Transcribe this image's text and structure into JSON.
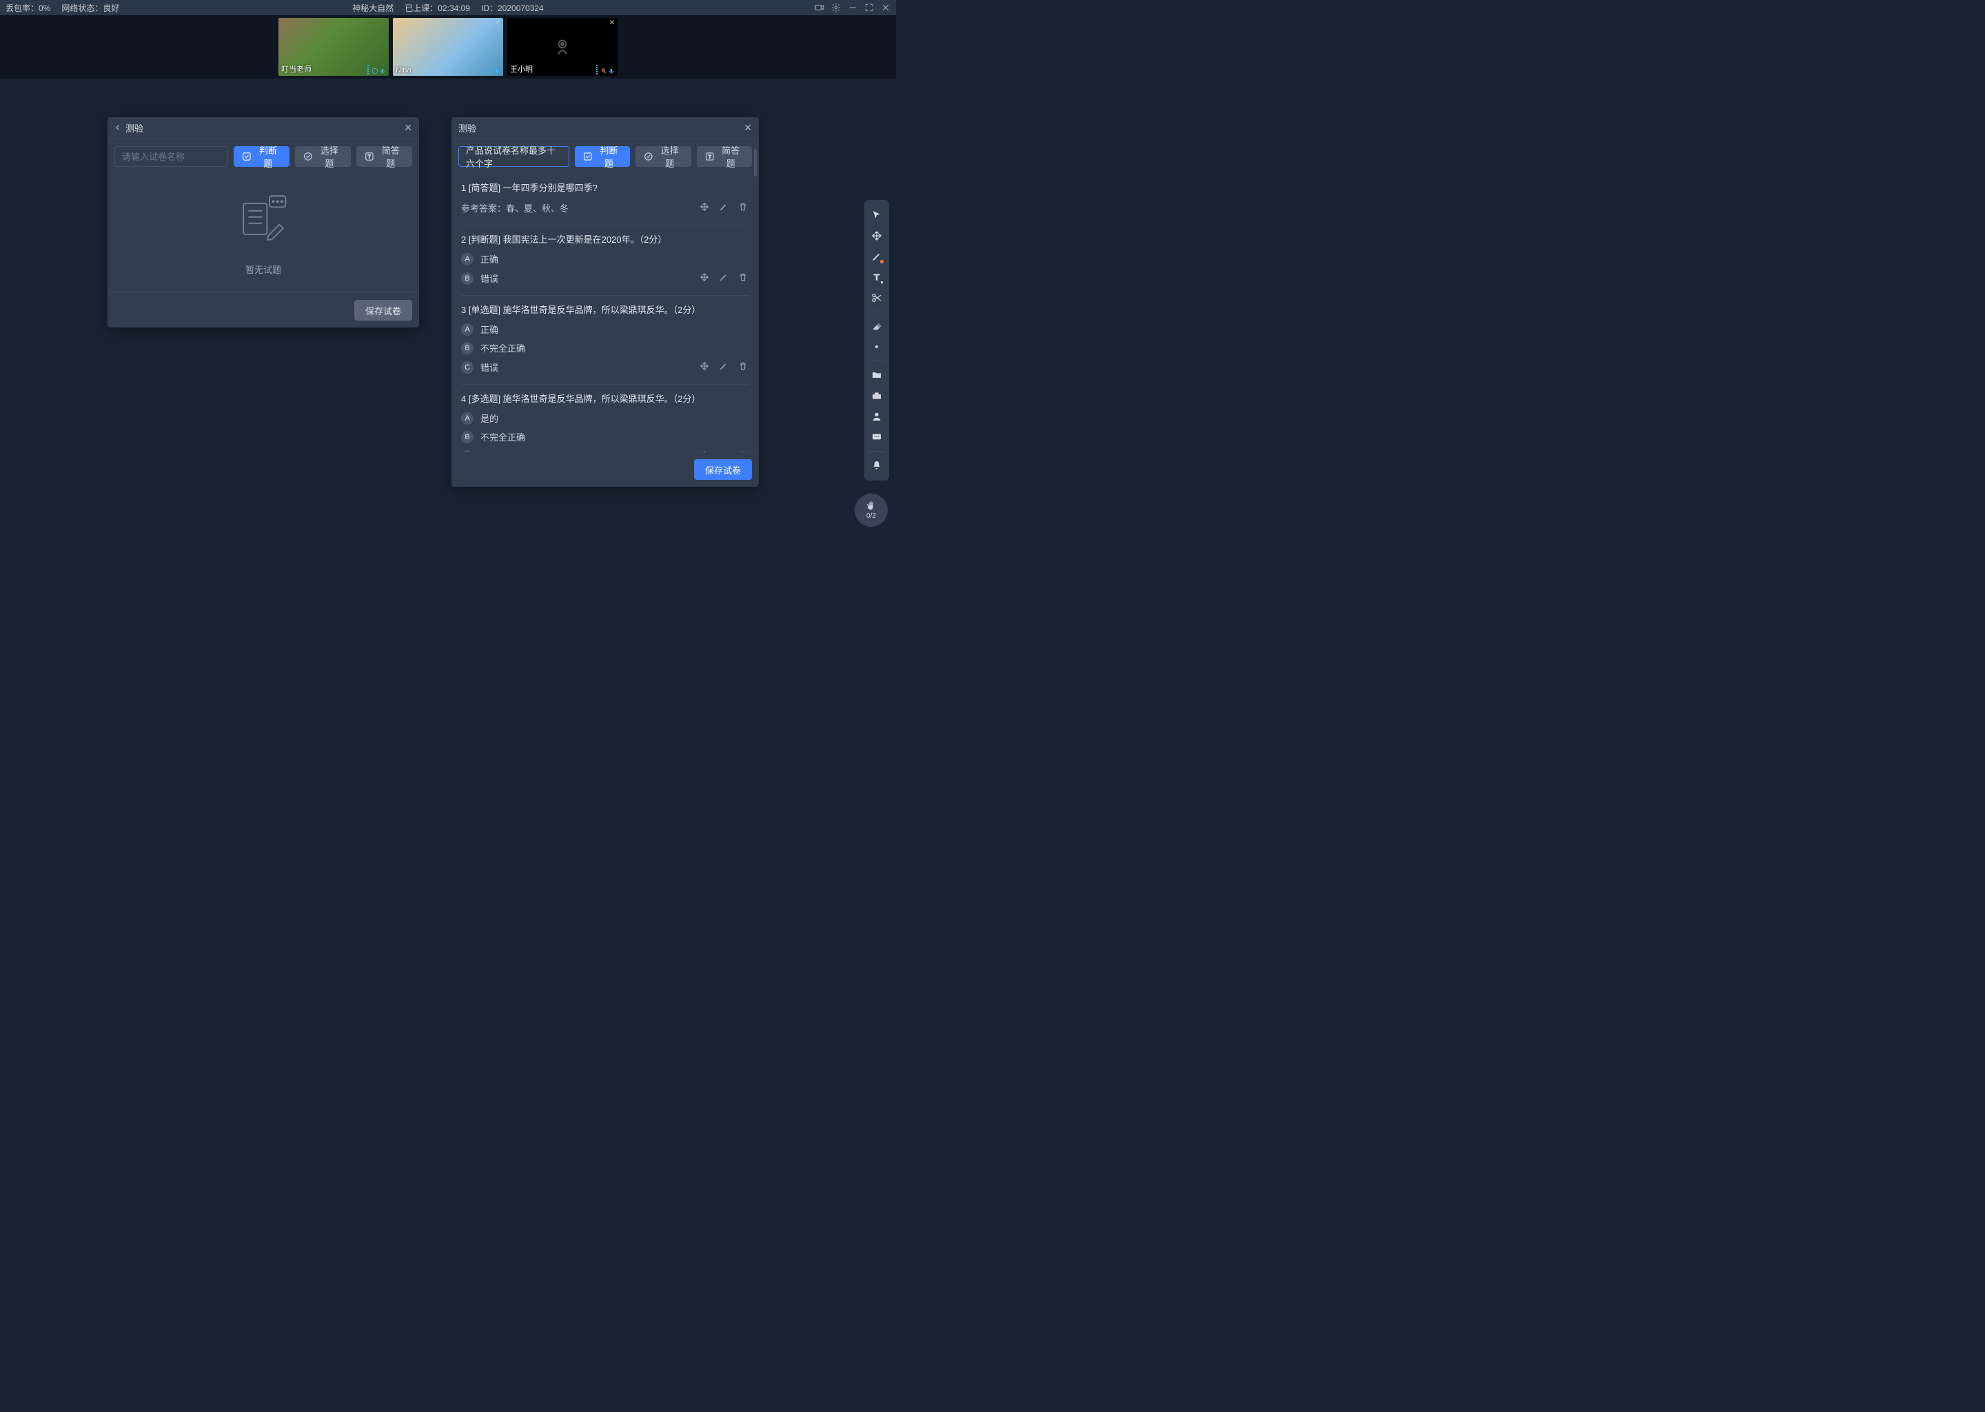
{
  "top_bar": {
    "packet_loss_label": "丢包率：0%",
    "network_label": "网络状态：良好",
    "course_title": "神秘大自然",
    "elapsed_label": "已上课：02:34:09",
    "session_id_label": "ID：2020070324"
  },
  "video_tiles": [
    {
      "name": "叮当老师",
      "has_close": false,
      "camera_off": false,
      "mic_muted": false
    },
    {
      "name": "Nina",
      "has_close": true,
      "camera_off": false,
      "mic_muted": false
    },
    {
      "name": "王小明",
      "has_close": true,
      "camera_off": true,
      "mic_muted": true
    }
  ],
  "panel_left": {
    "title": "测验",
    "name_placeholder": "请输入试卷名称",
    "buttons": {
      "judgment": "判断题",
      "choice": "选择题",
      "short_answer": "简答题"
    },
    "empty_text": "暂无试题",
    "save_button": "保存试卷"
  },
  "panel_right": {
    "title": "测验",
    "name_value": "产品说试卷名称最多十六个字",
    "buttons": {
      "judgment": "判断题",
      "choice": "选择题",
      "short_answer": "简答题"
    },
    "save_button": "保存试卷"
  },
  "questions": [
    {
      "num": "1",
      "title_prefix": "[简答题]",
      "text": "一年四季分别是哪四季?",
      "answer_label": "参考答案：春、夏、秋、冬",
      "options": []
    },
    {
      "num": "2",
      "title_prefix": "[判断题]",
      "text": "我国宪法上一次更新是在2020年。",
      "score_suffix": "（2分）",
      "options": [
        {
          "badge": "A",
          "text": "正确"
        },
        {
          "badge": "B",
          "text": "错误"
        }
      ]
    },
    {
      "num": "3",
      "title_prefix": "[单选题]",
      "text": "施华洛世奇是反华品牌，所以梁鼎琪反华。",
      "score_suffix": "（2分）",
      "options": [
        {
          "badge": "A",
          "text": "正确"
        },
        {
          "badge": "B",
          "text": "不完全正确"
        },
        {
          "badge": "C",
          "text": "错误"
        }
      ]
    },
    {
      "num": "4",
      "title_prefix": "[多选题]",
      "text": "施华洛世奇是反华品牌，所以梁鼎琪反华。",
      "score_suffix": "（2分）",
      "options": [
        {
          "badge": "A",
          "text": "是的"
        },
        {
          "badge": "B",
          "text": "不完全正确"
        },
        {
          "badge": "C",
          "text": "错误"
        }
      ]
    }
  ],
  "hand_raise_count": "0/2"
}
